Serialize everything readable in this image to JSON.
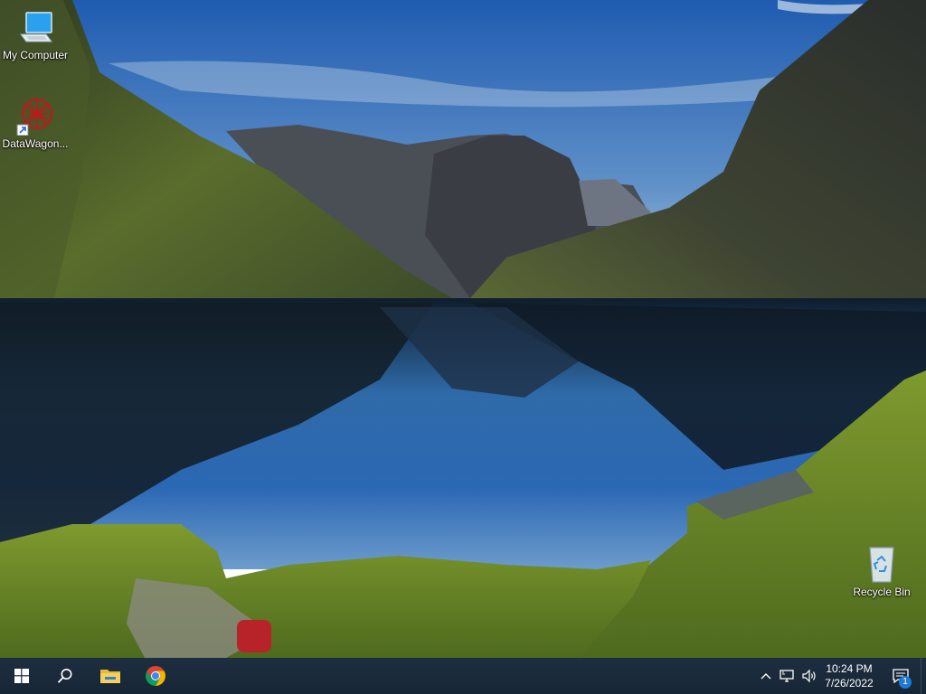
{
  "desktop": {
    "icons": [
      {
        "label": "My Computer",
        "icon": "computer-icon"
      },
      {
        "label": "DataWagon...",
        "icon": "datawagon-icon"
      },
      {
        "label": "Recycle Bin",
        "icon": "recycle-bin-icon"
      }
    ]
  },
  "taskbar": {
    "start_icon": "windows-logo-icon",
    "search_icon": "search-icon",
    "pinned": [
      {
        "name": "File Explorer",
        "icon": "folder-icon"
      },
      {
        "name": "Google Chrome",
        "icon": "chrome-icon"
      }
    ],
    "tray": {
      "chevron_icon": "chevron-up-icon",
      "network_icon": "network-icon",
      "volume_icon": "volume-icon"
    },
    "clock": {
      "time": "10:24 PM",
      "date": "7/26/2022"
    },
    "notifications": {
      "icon": "action-center-icon",
      "count": "1"
    }
  },
  "colors": {
    "taskbar": "#1b2a3a",
    "sky": "#2a66b8",
    "lake": "#1d5fa8",
    "grass": "#6f8f2a"
  }
}
